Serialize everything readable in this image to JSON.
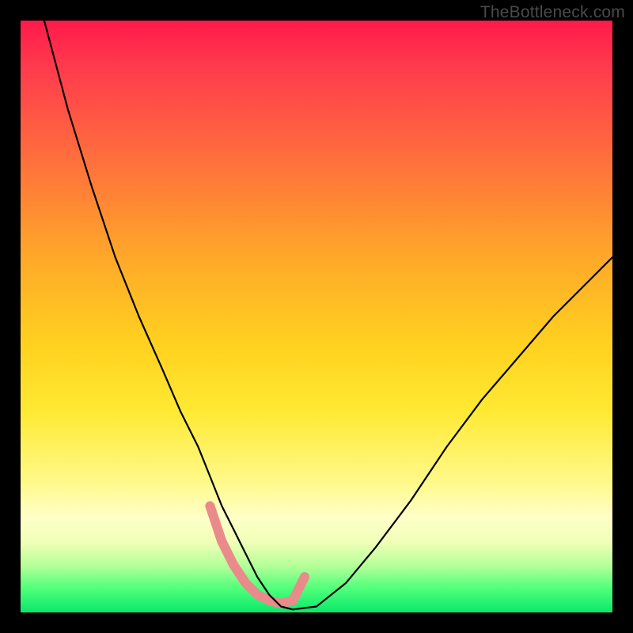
{
  "watermark": "TheBottleneck.com",
  "colors": {
    "frame": "#000000",
    "curve": "#000000",
    "flat_band": "#e98a8b"
  },
  "chart_data": {
    "type": "line",
    "title": "",
    "xlabel": "",
    "ylabel": "",
    "xlim": [
      0,
      100
    ],
    "ylim": [
      0,
      100
    ],
    "grid": false,
    "series": [
      {
        "name": "bottleneck-curve",
        "x": [
          4,
          8,
          12,
          16,
          20,
          24,
          27,
          30,
          32,
          34,
          36,
          38,
          40,
          42,
          44,
          46,
          50,
          55,
          60,
          66,
          72,
          78,
          84,
          90,
          96,
          100
        ],
        "y": [
          100,
          85,
          72,
          60,
          50,
          41,
          34,
          28,
          23,
          18,
          14,
          10,
          6,
          3,
          1,
          0.5,
          1,
          5,
          11,
          19,
          28,
          36,
          43,
          50,
          56,
          60
        ]
      }
    ],
    "flat_region": {
      "name": "optimal-band",
      "color": "#e98a8b",
      "x": [
        32,
        34,
        36,
        38,
        40,
        42,
        44,
        46,
        48
      ],
      "y": [
        18,
        12,
        8,
        5,
        3,
        2,
        1.5,
        2,
        6
      ]
    },
    "gradient_fill": {
      "top": "#ff1a4a",
      "mid": "#ffe933",
      "bottom": "#08e86b"
    }
  }
}
